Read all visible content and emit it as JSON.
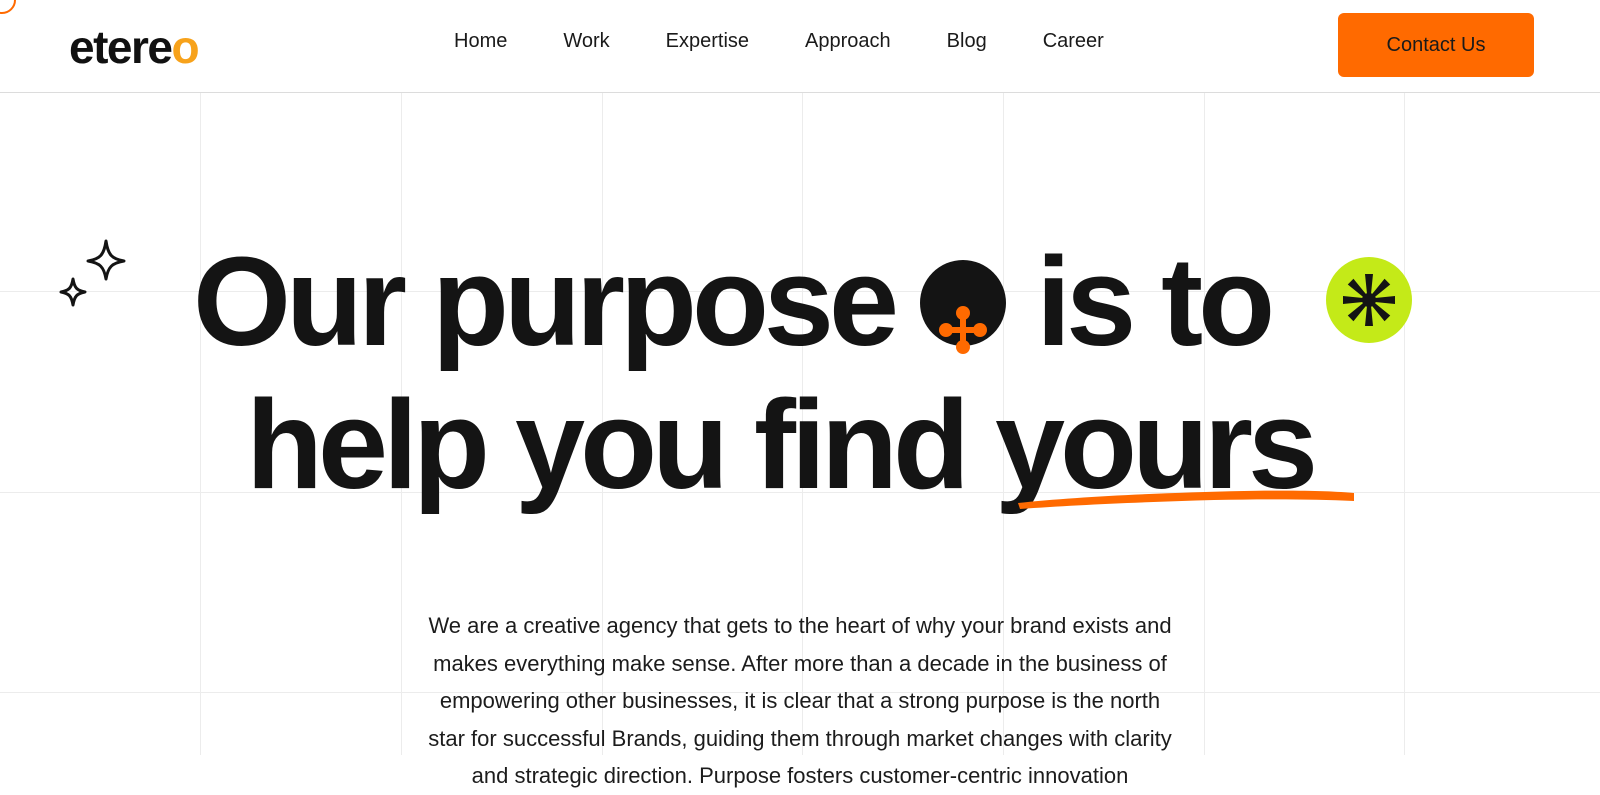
{
  "brand": {
    "logo_text": "etere",
    "logo_accent": "o",
    "accent_color": "#ff6a00",
    "logo_accent_color": "#f7a21b",
    "highlight_color": "#c4ea18"
  },
  "nav": {
    "items": [
      "Home",
      "Work",
      "Expertise",
      "Approach",
      "Blog",
      "Career"
    ]
  },
  "header": {
    "cta_label": "Contact Us"
  },
  "hero": {
    "line1_part1": "Our purpose",
    "line1_part2": "is to",
    "line2_part1": "help you find ",
    "line2_highlight": "yours",
    "icons": [
      "sparkle-icon",
      "dots-cross-icon",
      "asterisk-burst-icon",
      "brush-underline"
    ],
    "description": "We are a creative agency that gets to the heart of why your brand exists and makes everything make sense. After more than a decade in the business of empowering other businesses, it is clear that a strong purpose is the north star for successful Brands, guiding them through market changes with clarity and strategic direction. Purpose fosters customer-centric innovation"
  }
}
